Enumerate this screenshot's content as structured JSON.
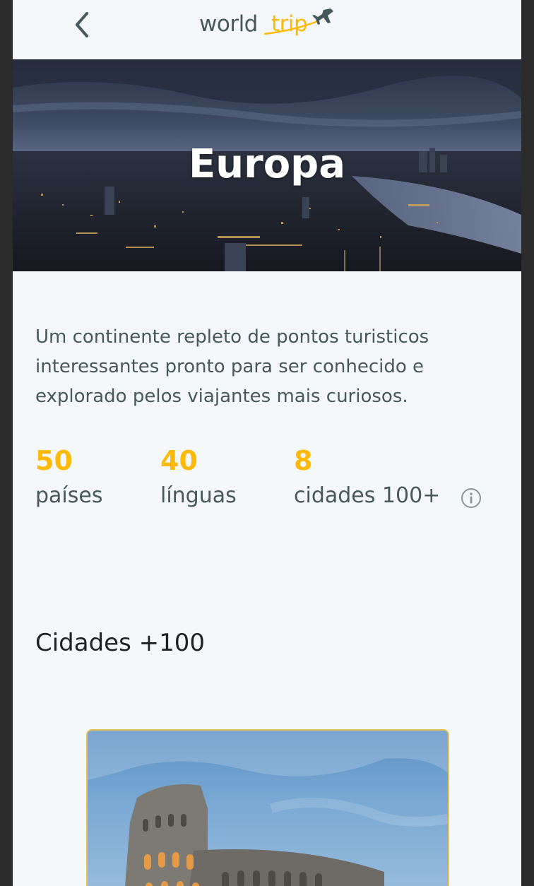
{
  "header": {
    "logo_world": "world",
    "logo_trip": "trip",
    "back_icon": "chevron-left-icon",
    "plane_icon": "airplane-icon"
  },
  "banner": {
    "title": "Europa"
  },
  "description": "Um continente repleto de pontos turisticos interessantes pronto para ser conhecido e explorado pelos viajantes mais curiosos.",
  "stats": [
    {
      "number": "50",
      "label": "países"
    },
    {
      "number": "40",
      "label": "línguas"
    },
    {
      "number": "8",
      "label": "cidades 100+"
    }
  ],
  "stats_info_icon": "info-icon",
  "section_title": "Cidades +100",
  "colors": {
    "accent": "#ffba08",
    "text_dark": "#47585b",
    "background": "#f5f8fa",
    "card_border": "#e9c24f"
  }
}
